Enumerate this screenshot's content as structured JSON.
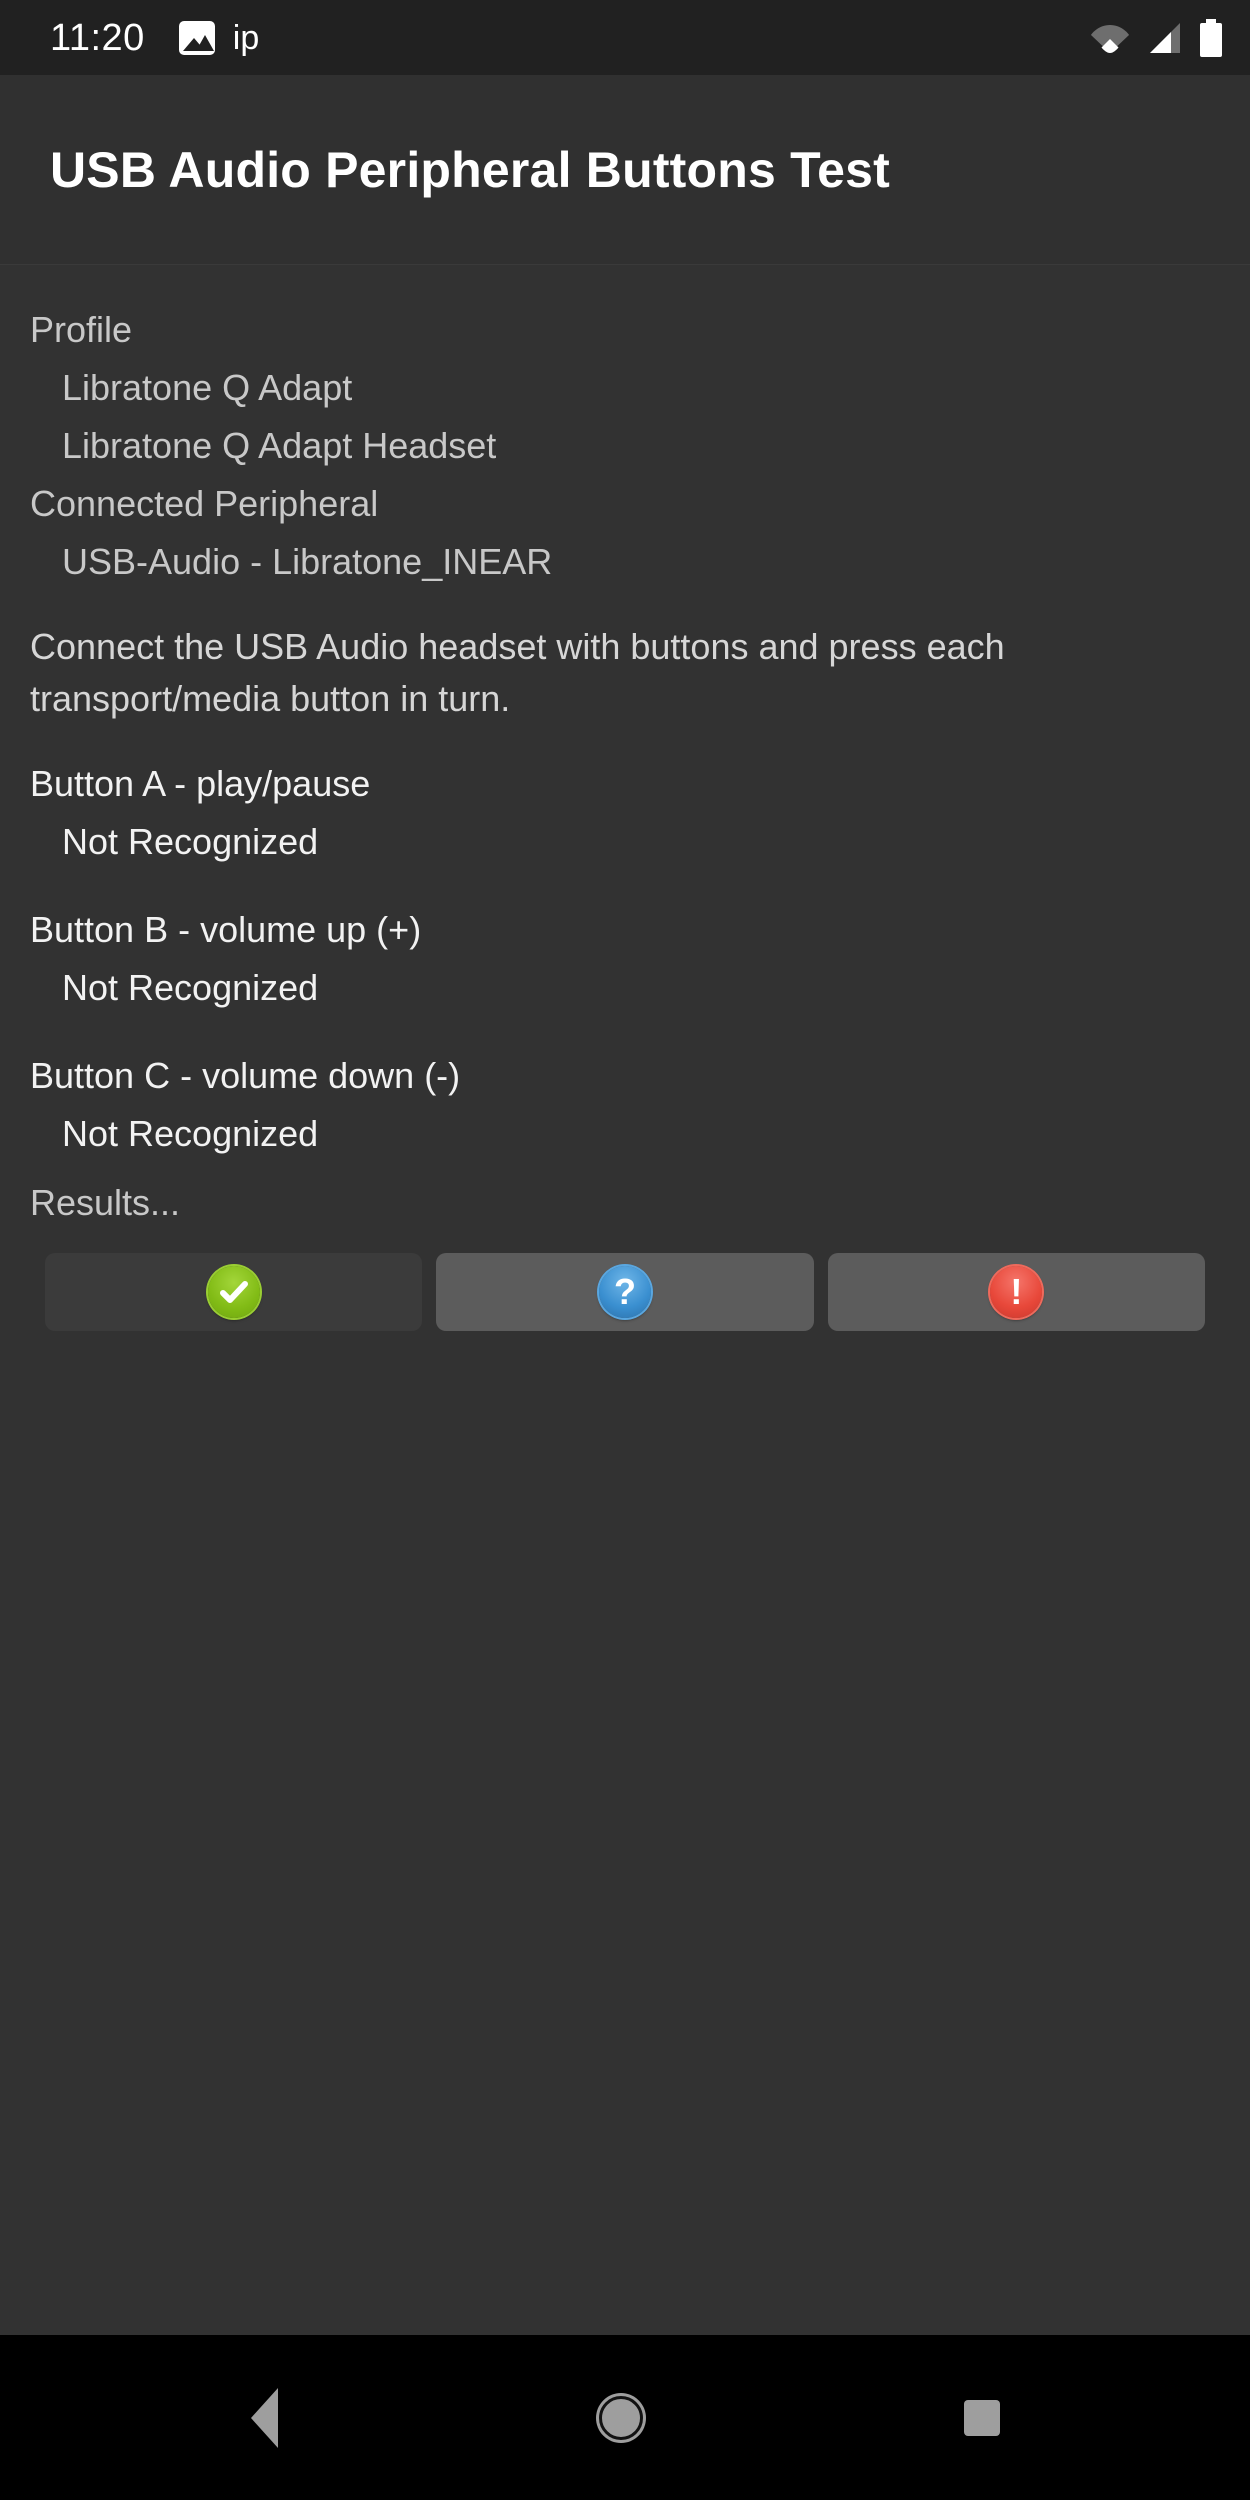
{
  "statusbar": {
    "clock": "11:20",
    "notification_label": "ip",
    "icons": [
      "photo-icon",
      "wifi-icon",
      "signal-icon",
      "battery-icon"
    ]
  },
  "appbar": {
    "title": "USB Audio Peripheral Buttons Test"
  },
  "content": {
    "profile_label": "Profile",
    "profile_value_1": "Libratone Q Adapt",
    "profile_value_2": "Libratone Q Adapt Headset",
    "connected_label": "Connected Peripheral",
    "connected_value": "USB-Audio - Libratone_INEAR",
    "instructions": "Connect the USB Audio headset with buttons and press each transport/media button in turn.",
    "buttons": [
      {
        "label": "Button A - play/pause",
        "status": "Not Recognized"
      },
      {
        "label": "Button B - volume up (+)",
        "status": "Not Recognized"
      },
      {
        "label": "Button C - volume down (-)",
        "status": "Not Recognized"
      }
    ],
    "results_label": "Results..."
  },
  "result_buttons": {
    "pass": {
      "icon": "check-circle-icon",
      "color": "#82bc16"
    },
    "info": {
      "icon": "question-circle-icon",
      "color": "#3a8fd0",
      "glyph": "?"
    },
    "fail": {
      "icon": "exclamation-circle-icon",
      "color": "#e8483a",
      "glyph": "!"
    }
  },
  "navbar": {
    "back": "back-icon",
    "home": "home-icon",
    "recent": "recents-icon"
  },
  "colors": {
    "background": "#323232",
    "appbar": "#303030",
    "statusbar": "#212121",
    "navbar": "#000000",
    "text_primary": "#ffffff",
    "text_secondary": "#c8c8c8"
  }
}
